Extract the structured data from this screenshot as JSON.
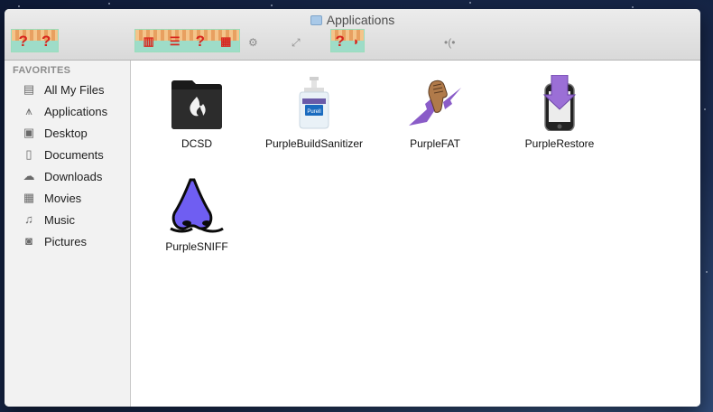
{
  "window": {
    "title": "Applications"
  },
  "sidebar": {
    "heading": "FAVORITES",
    "items": [
      {
        "label": "All My Files",
        "icon": "all-files-icon"
      },
      {
        "label": "Applications",
        "icon": "applications-icon"
      },
      {
        "label": "Desktop",
        "icon": "desktop-icon"
      },
      {
        "label": "Documents",
        "icon": "documents-icon"
      },
      {
        "label": "Downloads",
        "icon": "downloads-icon"
      },
      {
        "label": "Movies",
        "icon": "movies-icon"
      },
      {
        "label": "Music",
        "icon": "music-icon"
      },
      {
        "label": "Pictures",
        "icon": "pictures-icon"
      }
    ]
  },
  "apps": [
    {
      "name": "DCSD",
      "icon": "dcsd-flame-icon"
    },
    {
      "name": "PurpleBuildSanitizer",
      "icon": "sanitizer-bottle-icon"
    },
    {
      "name": "PurpleFAT",
      "icon": "fist-lightning-icon"
    },
    {
      "name": "PurpleRestore",
      "icon": "iphone-restore-icon"
    },
    {
      "name": "PurpleSNIFF",
      "icon": "purple-nose-icon"
    }
  ],
  "colors": {
    "accent": "#8a5cc8",
    "sidebar_bg": "#f2f2f2",
    "toolbar_bg": "#dcdcdc"
  }
}
